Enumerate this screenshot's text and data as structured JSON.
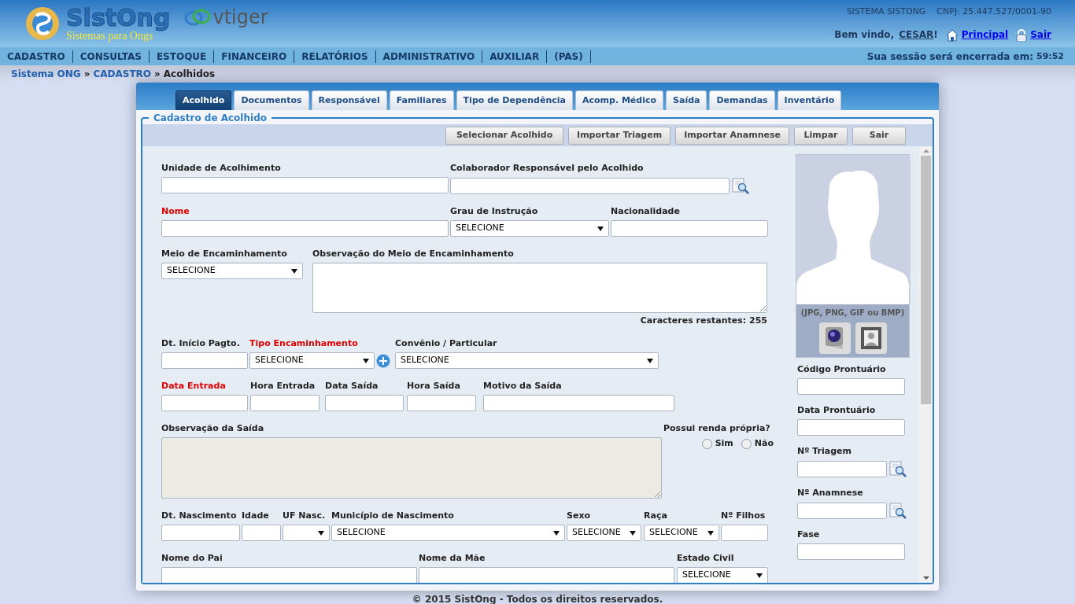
{
  "header": {
    "brand": "SistOng",
    "tagline": "Sistemas para Ongs",
    "partner": "vtiger",
    "system_name": "SISTEMA SISTONG",
    "cnpj": "CNPJ: 25.447.527/0001-90",
    "welcome": "Bem vindo,",
    "user": "CESAR",
    "exclaim": "!",
    "links": [
      {
        "label": "Principal",
        "kind": "home"
      },
      {
        "label": "Sair",
        "kind": "lock"
      }
    ]
  },
  "menu": {
    "items": [
      "CADASTRO",
      "CONSULTAS",
      "ESTOQUE",
      "FINANCEIRO",
      "RELATÓRIOS",
      "ADMINISTRATIVO",
      "AUXILIAR",
      "(PAS)"
    ],
    "session_label": "Sua sessão será encerrada em:",
    "session_time": "59:52"
  },
  "breadcrumb": {
    "items": [
      "Sistema ONG",
      "CADASTRO",
      "Acolhidos"
    ],
    "separator": "»"
  },
  "tabs": [
    {
      "label": "Acolhido",
      "selected": true
    },
    {
      "label": "Documentos",
      "selected": false
    },
    {
      "label": "Responsável",
      "selected": false
    },
    {
      "label": "Familiares",
      "selected": false
    },
    {
      "label": "Tipo de Dependência",
      "selected": false
    },
    {
      "label": "Acomp. Médico",
      "selected": false
    },
    {
      "label": "Saída",
      "selected": false
    },
    {
      "label": "Demandas",
      "selected": false
    },
    {
      "label": "Inventário",
      "selected": false
    }
  ],
  "legend": "Cadastro de Acolhido",
  "toolbar": [
    "Selecionar Acolhido",
    "Importar Triagem",
    "Importar Anamnese",
    "Limpar",
    "Sair"
  ],
  "form_rows": [
    [
      {
        "label": "Unidade de Acolhimento",
        "kind": "text",
        "required": false
      },
      {
        "label": "Colaborador Responsável pelo Acolhido",
        "kind": "text",
        "required": false,
        "lookup": true
      }
    ],
    [
      {
        "label": "Nome",
        "kind": "text",
        "required": true
      },
      {
        "label": "Grau de Instrução",
        "kind": "select",
        "required": false,
        "value": "SELECIONE"
      },
      {
        "label": "Nacionalidade",
        "kind": "text",
        "required": false
      }
    ],
    [
      {
        "label": "Meio de Encaminhamento",
        "kind": "select",
        "required": false,
        "value": "SELECIONE"
      },
      {
        "label": "Observação do Meio de Encaminhamento",
        "kind": "textarea",
        "required": false,
        "disabled": false,
        "counter": "Caracteres restantes: 255"
      }
    ],
    [
      {
        "label": "Dt. Início Pagto.",
        "kind": "text",
        "required": false
      },
      {
        "label": "Tipo Encaminhamento",
        "kind": "select",
        "required": true,
        "value": "SELECIONE",
        "add": true
      },
      {
        "label": "Convênio / Particular",
        "kind": "select",
        "required": false,
        "value": "SELECIONE"
      }
    ],
    [
      {
        "label": "Data Entrada",
        "kind": "text",
        "required": true
      },
      {
        "label": "Hora Entrada",
        "kind": "text",
        "required": false
      },
      {
        "label": "Data Saída",
        "kind": "text",
        "required": false
      },
      {
        "label": "Hora Saída",
        "kind": "text",
        "required": false
      },
      {
        "label": "Motivo da Saída",
        "kind": "text",
        "required": false
      }
    ],
    [
      {
        "label": "Observação da Saída",
        "kind": "textarea",
        "required": false,
        "disabled": true
      },
      {
        "label": "Possui renda própria?",
        "kind": "radio",
        "required": false,
        "options": [
          {
            "label": "Sim",
            "selected": false
          },
          {
            "label": "Não",
            "selected": false
          }
        ]
      }
    ],
    [
      {
        "label": "Dt. Nascimento",
        "kind": "text",
        "required": false
      },
      {
        "label": "Idade",
        "kind": "text",
        "required": false
      },
      {
        "label": "UF Nasc.",
        "kind": "select",
        "required": false
      },
      {
        "label": "Município de Nascimento",
        "kind": "select",
        "required": false,
        "value": "SELECIONE"
      },
      {
        "label": "Sexo",
        "kind": "select",
        "required": false,
        "value": "SELECIONE"
      },
      {
        "label": "Raça",
        "kind": "select",
        "required": false,
        "value": "SELECIONE"
      },
      {
        "label": "Nº Filhos",
        "kind": "text",
        "required": false
      }
    ],
    [
      {
        "label": "Nome do Pai",
        "kind": "text",
        "required": false
      },
      {
        "label": "Nome da Mãe",
        "kind": "text",
        "required": false
      },
      {
        "label": "Estado Civil",
        "kind": "select",
        "required": false,
        "value": "SELECIONE"
      }
    ]
  ],
  "photo": {
    "hint": "(JPG, PNG, GIF ou BMP)"
  },
  "side_fields": [
    {
      "label": "Código Prontuário"
    },
    {
      "label": "Data Prontuário"
    },
    {
      "label": "Nº Triagem",
      "lookup": true
    },
    {
      "label": "Nº Anamnese",
      "lookup": true
    },
    {
      "label": "Fase"
    }
  ],
  "footer": "© 2015 SistOng - Todos os direitos reservados."
}
